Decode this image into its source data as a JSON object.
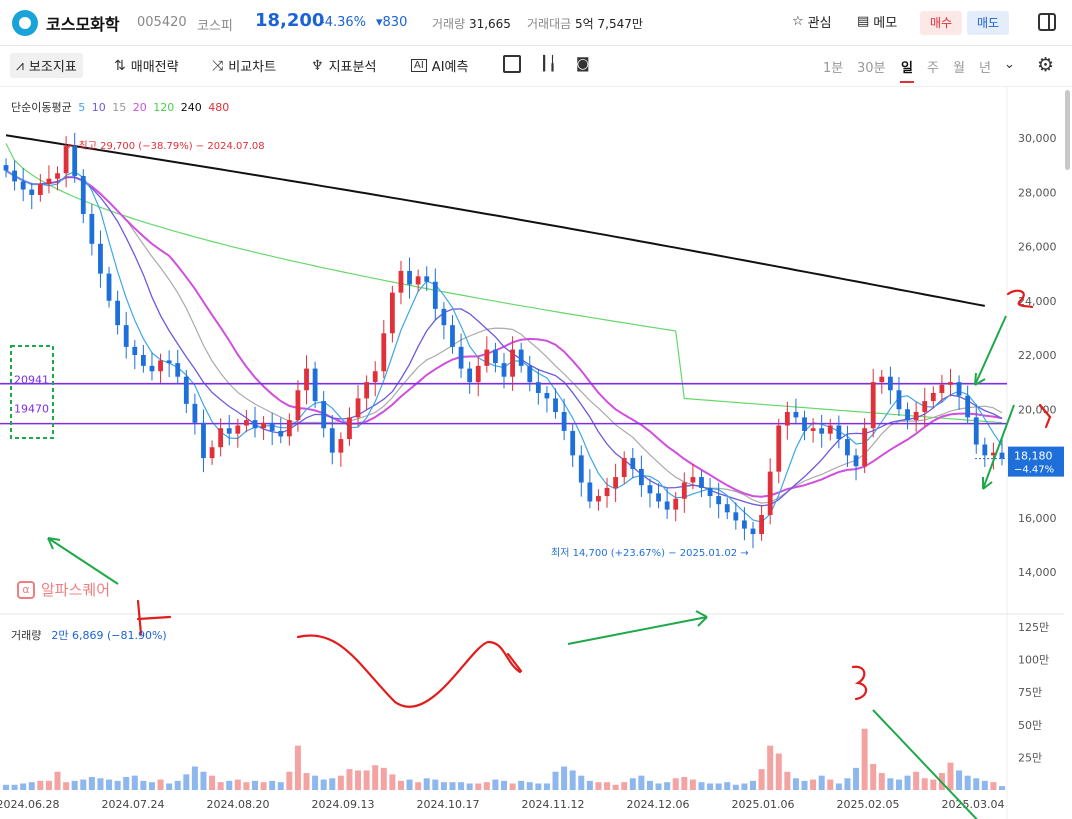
{
  "header": {
    "stock_name": "코스모화학",
    "code": "005420",
    "market": "코스피",
    "price": "18,200",
    "change_pct": "-4.36%",
    "change_val": "▾830",
    "volume_label": "거래량",
    "volume_value": "31,665",
    "amount_label": "거래대금",
    "amount_value": "5억 7,547만",
    "watch_label": "관심",
    "memo_label": "메모",
    "buy_label": "매수",
    "sell_label": "매도"
  },
  "toolbar": {
    "indicator_label": "보조지표",
    "strategy_label": "매매전략",
    "compare_label": "비교차트",
    "analysis_label": "지표분석",
    "ai_label": "AI예측",
    "periods": [
      "1분",
      "30분",
      "일",
      "주",
      "월",
      "년"
    ],
    "selected_period": "일"
  },
  "ma_legend": {
    "title": "단순이동평균",
    "items": [
      {
        "label": "5",
        "color": "#3fa6e8"
      },
      {
        "label": "10",
        "color": "#6a5ce0"
      },
      {
        "label": "15",
        "color": "#999999"
      },
      {
        "label": "20",
        "color": "#d04fdc"
      },
      {
        "label": "120",
        "color": "#4ad04a"
      },
      {
        "label": "240",
        "color": "#111111"
      },
      {
        "label": "480",
        "color": "#e0303a"
      }
    ]
  },
  "volume_legend": {
    "title": "거래량",
    "value": "2만 6,869 (−81.90%)"
  },
  "watermark": "알파스퀘어",
  "chart_data": {
    "type": "candlestick",
    "price_axis_ticks": [
      "30,000",
      "28,000",
      "26,000",
      "24,000",
      "22,000",
      "20,000",
      "16,000",
      "14,000"
    ],
    "volume_axis_ticks": [
      "125만",
      "100만",
      "75만",
      "50만",
      "25만"
    ],
    "date_ticks": [
      "2024.06.28",
      "2024.07.24",
      "2024.08.20",
      "2024.09.13",
      "2024.10.17",
      "2024.11.12",
      "2024.12.06",
      "2025.01.06",
      "2025.02.05",
      "2025.03.04"
    ],
    "high_annotation": "최고 29,700 (−38.79%) − 2024.07.08",
    "low_annotation": "최저 14,700 (+23.67%) − 2025.01.02",
    "current_price_label": "18,180",
    "current_change_label": "−4.47%",
    "levels": [
      {
        "value": 20941,
        "label": "20941"
      },
      {
        "value": 19470,
        "label": "19470"
      }
    ],
    "close_series": [
      28800,
      28400,
      28100,
      27900,
      28300,
      28500,
      28700,
      29700,
      28600,
      27200,
      26100,
      25000,
      24000,
      23100,
      22300,
      22000,
      21600,
      21400,
      21800,
      21700,
      21200,
      20200,
      19500,
      18200,
      18600,
      19300,
      19100,
      19400,
      19600,
      19300,
      19500,
      19200,
      19000,
      19600,
      20700,
      21500,
      20300,
      19300,
      18400,
      18900,
      19700,
      20400,
      21000,
      21400,
      22800,
      24300,
      25100,
      24600,
      24900,
      24700,
      23700,
      23100,
      22300,
      21500,
      21000,
      21600,
      22200,
      21700,
      21200,
      22200,
      21600,
      21000,
      20600,
      20400,
      19900,
      19200,
      18300,
      17300,
      16600,
      16800,
      17100,
      17500,
      18200,
      17800,
      17200,
      16900,
      16600,
      16300,
      16700,
      17300,
      17500,
      17100,
      16800,
      16500,
      16200,
      15900,
      15600,
      15400,
      16100,
      17700,
      19400,
      19900,
      19700,
      19200,
      19300,
      19100,
      19400,
      18900,
      18300,
      17900,
      19300,
      21000,
      21200,
      20700,
      20000,
      19600,
      19900,
      20300,
      20600,
      20900,
      21000,
      20500,
      19700,
      18700,
      18300,
      18400,
      18180
    ],
    "volume_series_man": [
      4,
      4,
      5,
      6,
      7,
      7,
      14,
      6,
      7,
      8,
      10,
      9,
      8,
      7,
      10,
      11,
      7,
      6,
      8,
      5,
      7,
      12,
      18,
      14,
      11,
      6,
      7,
      8,
      6,
      7,
      6,
      7,
      6,
      14,
      34,
      13,
      11,
      8,
      9,
      11,
      16,
      15,
      15,
      19,
      17,
      12,
      7,
      8,
      6,
      9,
      8,
      6,
      6,
      6,
      5,
      5,
      6,
      8,
      7,
      5,
      7,
      6,
      5,
      5,
      14,
      18,
      15,
      11,
      7,
      6,
      6,
      4,
      6,
      9,
      11,
      7,
      5,
      6,
      9,
      10,
      8,
      6,
      5,
      5,
      6,
      4,
      5,
      7,
      16,
      34,
      28,
      14,
      9,
      7,
      8,
      11,
      8,
      5,
      9,
      17,
      47,
      20,
      13,
      9,
      8,
      11,
      14,
      9,
      8,
      13,
      21,
      15,
      11,
      9,
      7,
      6,
      3
    ]
  }
}
